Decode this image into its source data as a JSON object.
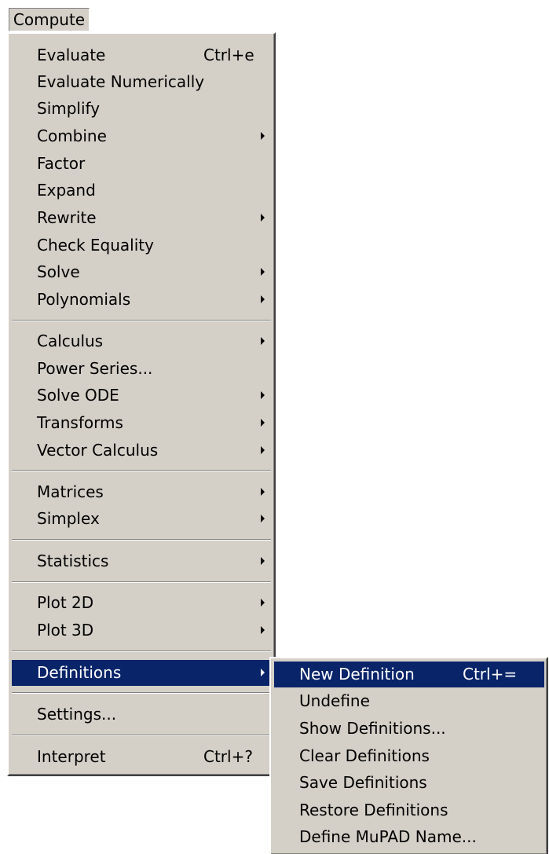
{
  "menubar": {
    "compute_label": "Compute"
  },
  "menu": {
    "evaluate": {
      "label": "Evaluate",
      "shortcut": "Ctrl+e"
    },
    "evaluate_numerically": {
      "label": "Evaluate Numerically"
    },
    "simplify": {
      "label": "Simplify"
    },
    "combine": {
      "label": "Combine"
    },
    "factor": {
      "label": "Factor"
    },
    "expand": {
      "label": "Expand"
    },
    "rewrite": {
      "label": "Rewrite"
    },
    "check_equality": {
      "label": "Check Equality"
    },
    "solve": {
      "label": "Solve"
    },
    "polynomials": {
      "label": "Polynomials"
    },
    "calculus": {
      "label": "Calculus"
    },
    "power_series": {
      "label": "Power Series..."
    },
    "solve_ode": {
      "label": "Solve ODE"
    },
    "transforms": {
      "label": "Transforms"
    },
    "vector_calculus": {
      "label": "Vector Calculus"
    },
    "matrices": {
      "label": "Matrices"
    },
    "simplex": {
      "label": "Simplex"
    },
    "statistics": {
      "label": "Statistics"
    },
    "plot_2d": {
      "label": "Plot 2D"
    },
    "plot_3d": {
      "label": "Plot 3D"
    },
    "definitions": {
      "label": "Definitions"
    },
    "settings": {
      "label": "Settings..."
    },
    "interpret": {
      "label": "Interpret",
      "shortcut": "Ctrl+?"
    }
  },
  "submenu": {
    "new_definition": {
      "label": "New Definition",
      "shortcut": "Ctrl+="
    },
    "undefine": {
      "label": "Undefine"
    },
    "show_definitions": {
      "label": "Show Definitions..."
    },
    "clear_definitions": {
      "label": "Clear Definitions"
    },
    "save_definitions": {
      "label": "Save Definitions"
    },
    "restore_definitions": {
      "label": "Restore Definitions"
    },
    "define_mupad_name": {
      "label": "Define MuPAD Name..."
    }
  },
  "colors": {
    "menu_bg": "#d4d0c8",
    "highlight_bg": "#0a246a",
    "highlight_text": "#ffffff"
  }
}
